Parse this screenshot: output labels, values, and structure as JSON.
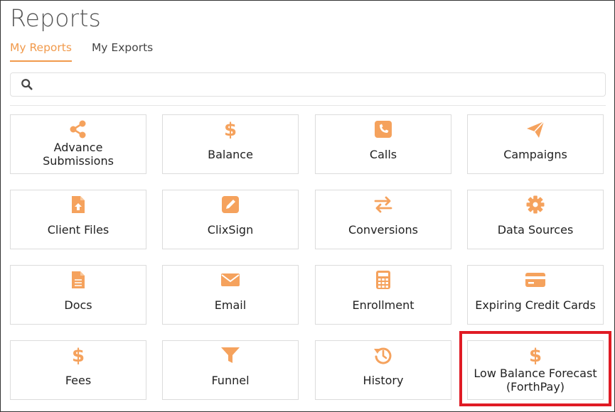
{
  "page": {
    "title": "Reports",
    "tabs": [
      "My Reports",
      "My Exports"
    ],
    "active_tab": "My Reports"
  },
  "search": {
    "value": "",
    "placeholder": ""
  },
  "tiles": [
    {
      "label": "Advance\nSubmissions",
      "icon": "share-icon"
    },
    {
      "label": "Balance",
      "icon": "dollar-icon"
    },
    {
      "label": "Calls",
      "icon": "phone-icon"
    },
    {
      "label": "Campaigns",
      "icon": "paper-plane-icon"
    },
    {
      "label": "Client Files",
      "icon": "file-upload-icon"
    },
    {
      "label": "ClixSign",
      "icon": "pencil-square-icon"
    },
    {
      "label": "Conversions",
      "icon": "exchange-icon"
    },
    {
      "label": "Data Sources",
      "icon": "gear-icon"
    },
    {
      "label": "Docs",
      "icon": "document-icon"
    },
    {
      "label": "Email",
      "icon": "envelope-icon"
    },
    {
      "label": "Enrollment",
      "icon": "calculator-icon"
    },
    {
      "label": "Expiring Credit Cards",
      "icon": "credit-card-icon"
    },
    {
      "label": "Fees",
      "icon": "dollar-icon"
    },
    {
      "label": "Funnel",
      "icon": "filter-icon"
    },
    {
      "label": "History",
      "icon": "history-icon"
    },
    {
      "label": "Low Balance Forecast\n(ForthPay)",
      "icon": "dollar-icon"
    }
  ],
  "highlighted_tile": "Low Balance Forecast\n(ForthPay)",
  "colors": {
    "accent": "#f19a4c",
    "icon": "#f5a25d",
    "highlight": "#e01b24"
  }
}
